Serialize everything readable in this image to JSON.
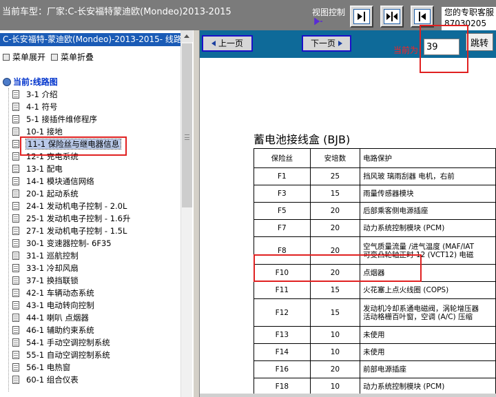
{
  "topbar": {
    "car_model": "当前车型：厂家:C-长安福特蒙迪欧(Mondeo)2013-2015",
    "view_control_label": "视图控制",
    "agent_line1": "您的专职客服",
    "agent_line2": "87030205"
  },
  "left": {
    "title": "C-长安福特-蒙迪欧(Mondeo)-2013-2015- 线路图",
    "expand_all": "菜单展开",
    "collapse_all": "菜单折叠",
    "root": "当前:线路图",
    "items": [
      "3-1 介绍",
      "4-1 符号",
      "5-1 接插件维修程序",
      "10-1 接地",
      "11-1 保险丝与继电器信息",
      "12-1 充电系统",
      "13-1 配电",
      "14-1 模块通信网络",
      "20-1 起动系统",
      "24-1 发动机电子控制 - 2.0L",
      "25-1 发动机电子控制 - 1.6升",
      "27-1 发动机电子控制 - 1.5L",
      "30-1 变速器控制- 6F35",
      "31-1 巡航控制",
      "33-1 冷却风扇",
      "37-1 换挡联锁",
      "42-1 车辆动态系统",
      "43-1 电动转向控制",
      "44-1 喇叭 点烟器",
      "46-1 辅助约束系统",
      "54-1 手动空调控制系统",
      "55-1 自动空调控制系统",
      "56-1 电热窗",
      "60-1 组合仪表"
    ]
  },
  "nav": {
    "prev": "上一页",
    "next": "下一页",
    "current_label": "当前为",
    "current_page": "39",
    "jump": "跳转"
  },
  "doc": {
    "title": "蓄电池接线盒 (BJB)",
    "headers": [
      "保险丝",
      "安培数",
      "电路保护"
    ],
    "rows": [
      [
        "F1",
        "25",
        "挡风玻 璃雨刮器 电机，右前"
      ],
      [
        "F3",
        "15",
        "雨量传感器模块"
      ],
      [
        "F5",
        "20",
        "后部乘客侧电源插座"
      ],
      [
        "F7",
        "20",
        "动力系统控制模块 (PCM)"
      ],
      [
        "F8",
        "20",
        "空气质量流量 /进气温度 (MAF/IAT\n可变凸轮轴正时 12 (VCT12) 电磁"
      ],
      [
        "F10",
        "20",
        "点烟器"
      ],
      [
        "F11",
        "15",
        "火花塞上点火线圈 (COPS)"
      ],
      [
        "F12",
        "15",
        "发动机冷却系通电磁阀，涡轮增压器\n活动格栅百叶窗，空调 (A/C) 压缩"
      ],
      [
        "F13",
        "10",
        "未使用"
      ],
      [
        "F14",
        "10",
        "未使用"
      ],
      [
        "F16",
        "20",
        "前部电源插座"
      ],
      [
        "F18",
        "10",
        "动力系统控制模块 (PCM)"
      ]
    ]
  },
  "colors": {
    "topbar": "#7b7b7b",
    "left_title": "#1a5bb6",
    "nav_bar": "#0e6a99",
    "highlight_red": "#e02020"
  }
}
